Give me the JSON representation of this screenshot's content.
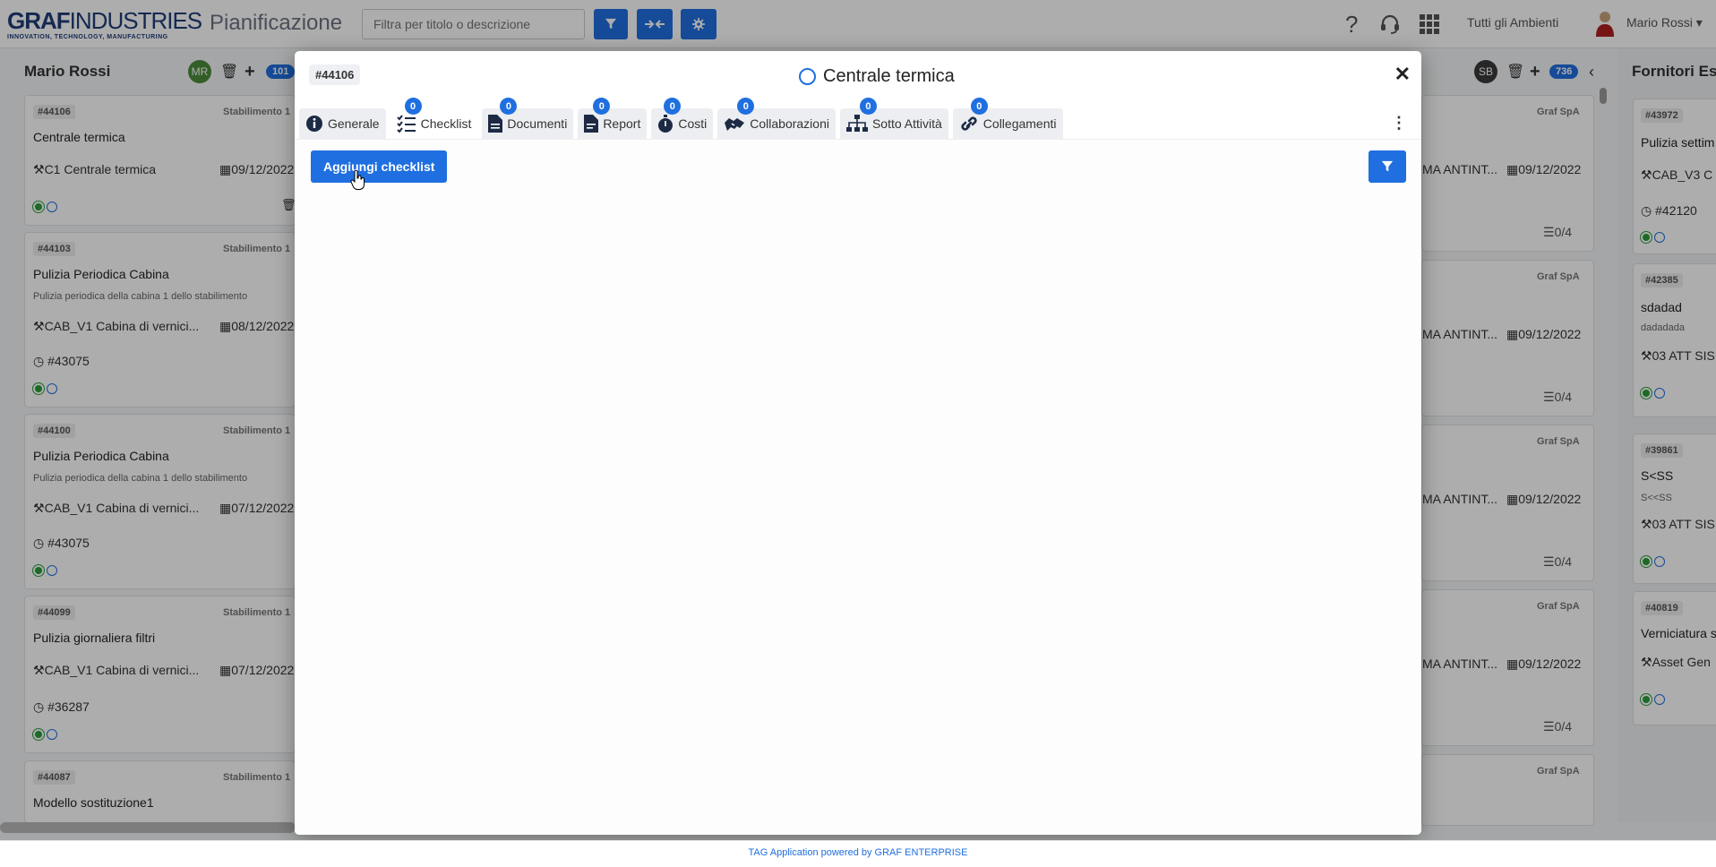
{
  "header": {
    "logo_main_bold": "GRAF",
    "logo_main_thin": "INDUSTRIES",
    "logo_tagline": "INNOVATION, TECHNOLOGY, MANUFACTURING",
    "app_title": "Pianificazione",
    "search_placeholder": "Filtra per titolo o descrizione",
    "environment": "Tutti gli Ambienti",
    "user_name": "Mario Rossi",
    "icons": [
      "filter-icon",
      "compress-icon",
      "gear-icon",
      "help-icon",
      "headset-icon",
      "apps-grid-icon"
    ]
  },
  "columns": {
    "left": {
      "name": "Mario Rossi",
      "avatar": "MR",
      "count": "101",
      "cards": [
        {
          "id": "#44106",
          "plant": "Stabilimento 1",
          "title": "Centrale termica",
          "desc": "",
          "asset": "C1 Centrale termica",
          "date": "09/12/2022",
          "ref": ""
        },
        {
          "id": "#44103",
          "plant": "Stabilimento 1",
          "title": "Pulizia Periodica Cabina",
          "desc": "Pulizia periodica della cabina 1 dello stabilimento",
          "asset": "CAB_V1 Cabina di vernici...",
          "date": "08/12/2022",
          "ref": "#43075"
        },
        {
          "id": "#44100",
          "plant": "Stabilimento 1",
          "title": "Pulizia Periodica Cabina",
          "desc": "Pulizia periodica della cabina 1 dello stabilimento",
          "asset": "CAB_V1 Cabina di vernici...",
          "date": "07/12/2022",
          "ref": "#43075"
        },
        {
          "id": "#44099",
          "plant": "Stabilimento 1",
          "title": "Pulizia giornaliera filtri",
          "desc": "",
          "asset": "CAB_V1 Cabina di vernici...",
          "date": "07/12/2022",
          "ref": "#36287"
        },
        {
          "id": "#44087",
          "plant": "Stabilimento 1",
          "title": "Modello sostituzione1",
          "desc": "",
          "asset": "",
          "date": "",
          "ref": ""
        }
      ]
    },
    "middle": {
      "avatar": "SB",
      "count": "736",
      "cards": [
        {
          "company": "Graf SpA",
          "asset": "MA ANTINT...",
          "date": "09/12/2022",
          "count": "0/4"
        },
        {
          "company": "Graf SpA",
          "asset": "MA ANTINT...",
          "date": "09/12/2022",
          "count": "0/4"
        },
        {
          "company": "Graf SpA",
          "asset": "MA ANTINT...",
          "date": "09/12/2022",
          "count": "0/4"
        },
        {
          "company": "Graf SpA",
          "asset": "MA ANTINT...",
          "date": "09/12/2022",
          "count": "0/4"
        },
        {
          "company": "Graf SpA",
          "asset": "",
          "date": "",
          "count": ""
        }
      ]
    },
    "right": {
      "name": "Fornitori Est",
      "cards": [
        {
          "id": "#43972",
          "title": "Pulizia settim",
          "desc": "",
          "asset": "CAB_V3 C",
          "ref": "#42120"
        },
        {
          "id": "#42385",
          "title": "sdadad",
          "desc": "dadadada",
          "asset": "03 ATT SIS",
          "ref": ""
        },
        {
          "id": "#39861",
          "title": "S<SS",
          "desc": "S<<SS",
          "asset": "03 ATT SIS",
          "ref": ""
        },
        {
          "id": "#40819",
          "title": "Verniciatura s",
          "desc": "",
          "asset": "Asset Gen",
          "ref": ""
        }
      ]
    }
  },
  "modal": {
    "id": "#44106",
    "title": "Centrale termica",
    "tabs": [
      {
        "label": "Generale",
        "icon": "info-icon",
        "badge": ""
      },
      {
        "label": "Checklist",
        "icon": "checklist-icon",
        "badge": "0"
      },
      {
        "label": "Documenti",
        "icon": "document-icon",
        "badge": "0"
      },
      {
        "label": "Report",
        "icon": "report-icon",
        "badge": "0"
      },
      {
        "label": "Costi",
        "icon": "stopwatch-icon",
        "badge": "0"
      },
      {
        "label": "Collaborazioni",
        "icon": "handshake-icon",
        "badge": "0"
      },
      {
        "label": "Sotto Attività",
        "icon": "sitemap-icon",
        "badge": "0"
      },
      {
        "label": "Collegamenti",
        "icon": "link-icon",
        "badge": "0"
      }
    ],
    "active_tab": "Checklist",
    "add_button": "Aggiungi checklist"
  },
  "footer": {
    "text": "TAG Application powered by GRAF ENTERPRISE"
  },
  "colors": {
    "accent": "#1f6fe0",
    "status_green": "#2a9d3a",
    "overlay": "rgba(0,0,0,0.32)"
  }
}
